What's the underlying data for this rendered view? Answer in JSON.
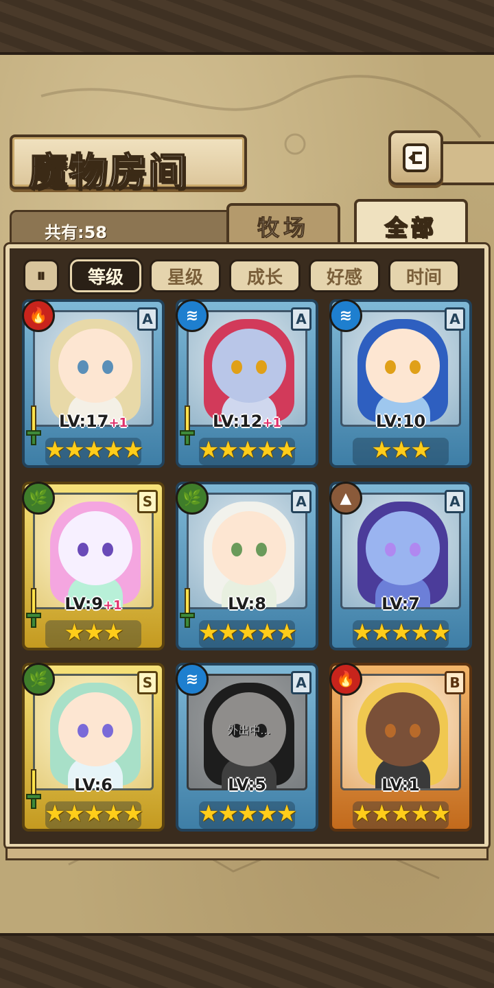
{
  "header": {
    "title": "魔物房间",
    "back_icon": "↩"
  },
  "summary": {
    "count_label": "共有:58"
  },
  "tabs": [
    {
      "label": "牧场",
      "active": false
    },
    {
      "label": "全部",
      "active": true
    }
  ],
  "sort": {
    "toggle_icon": "⏸",
    "options": [
      {
        "label": "等级",
        "active": true
      },
      {
        "label": "星级",
        "active": false
      },
      {
        "label": "成长",
        "active": false
      },
      {
        "label": "好感",
        "active": false
      },
      {
        "label": "时间",
        "active": false
      }
    ]
  },
  "monsters": [
    {
      "element": "fire",
      "rank": "A",
      "level": "LV:17",
      "bonus": "+1",
      "stars": "★★★★★",
      "frame": "blue",
      "away": ""
    },
    {
      "element": "water",
      "rank": "A",
      "level": "LV:12",
      "bonus": "+1",
      "stars": "★★★★★",
      "frame": "blue",
      "away": ""
    },
    {
      "element": "water",
      "rank": "A",
      "level": "LV:10",
      "bonus": "",
      "stars": "★★★",
      "frame": "blue",
      "away": ""
    },
    {
      "element": "wood",
      "rank": "S",
      "level": "LV:9",
      "bonus": "+1",
      "stars": "★★★",
      "frame": "gold",
      "away": ""
    },
    {
      "element": "wood",
      "rank": "A",
      "level": "LV:8",
      "bonus": "",
      "stars": "★★★★★",
      "frame": "blue",
      "away": ""
    },
    {
      "element": "earth",
      "rank": "A",
      "level": "LV:7",
      "bonus": "",
      "stars": "★★★★★",
      "frame": "blue",
      "away": ""
    },
    {
      "element": "wood",
      "rank": "S",
      "level": "LV:6",
      "bonus": "",
      "stars": "★★★★★",
      "frame": "gold",
      "away": ""
    },
    {
      "element": "water",
      "rank": "A",
      "level": "LV:5",
      "bonus": "",
      "stars": "★★★★★",
      "frame": "blue",
      "away": "外出中..."
    },
    {
      "element": "fire",
      "rank": "B",
      "level": "LV:1",
      "bonus": "",
      "stars": "★★★★★",
      "frame": "orange",
      "away": ""
    }
  ],
  "element_glyphs": {
    "fire": "🔥",
    "water": "≋",
    "wood": "🌿",
    "earth": "▲"
  },
  "colors": {
    "parchment": "#bda878",
    "board": "#3a2c1e",
    "frame_blue": "#3e7ea6",
    "frame_gold": "#c49a20",
    "frame_orange": "#c26a1c",
    "star": "#ffcd1a",
    "bonus": "#e0306a"
  }
}
